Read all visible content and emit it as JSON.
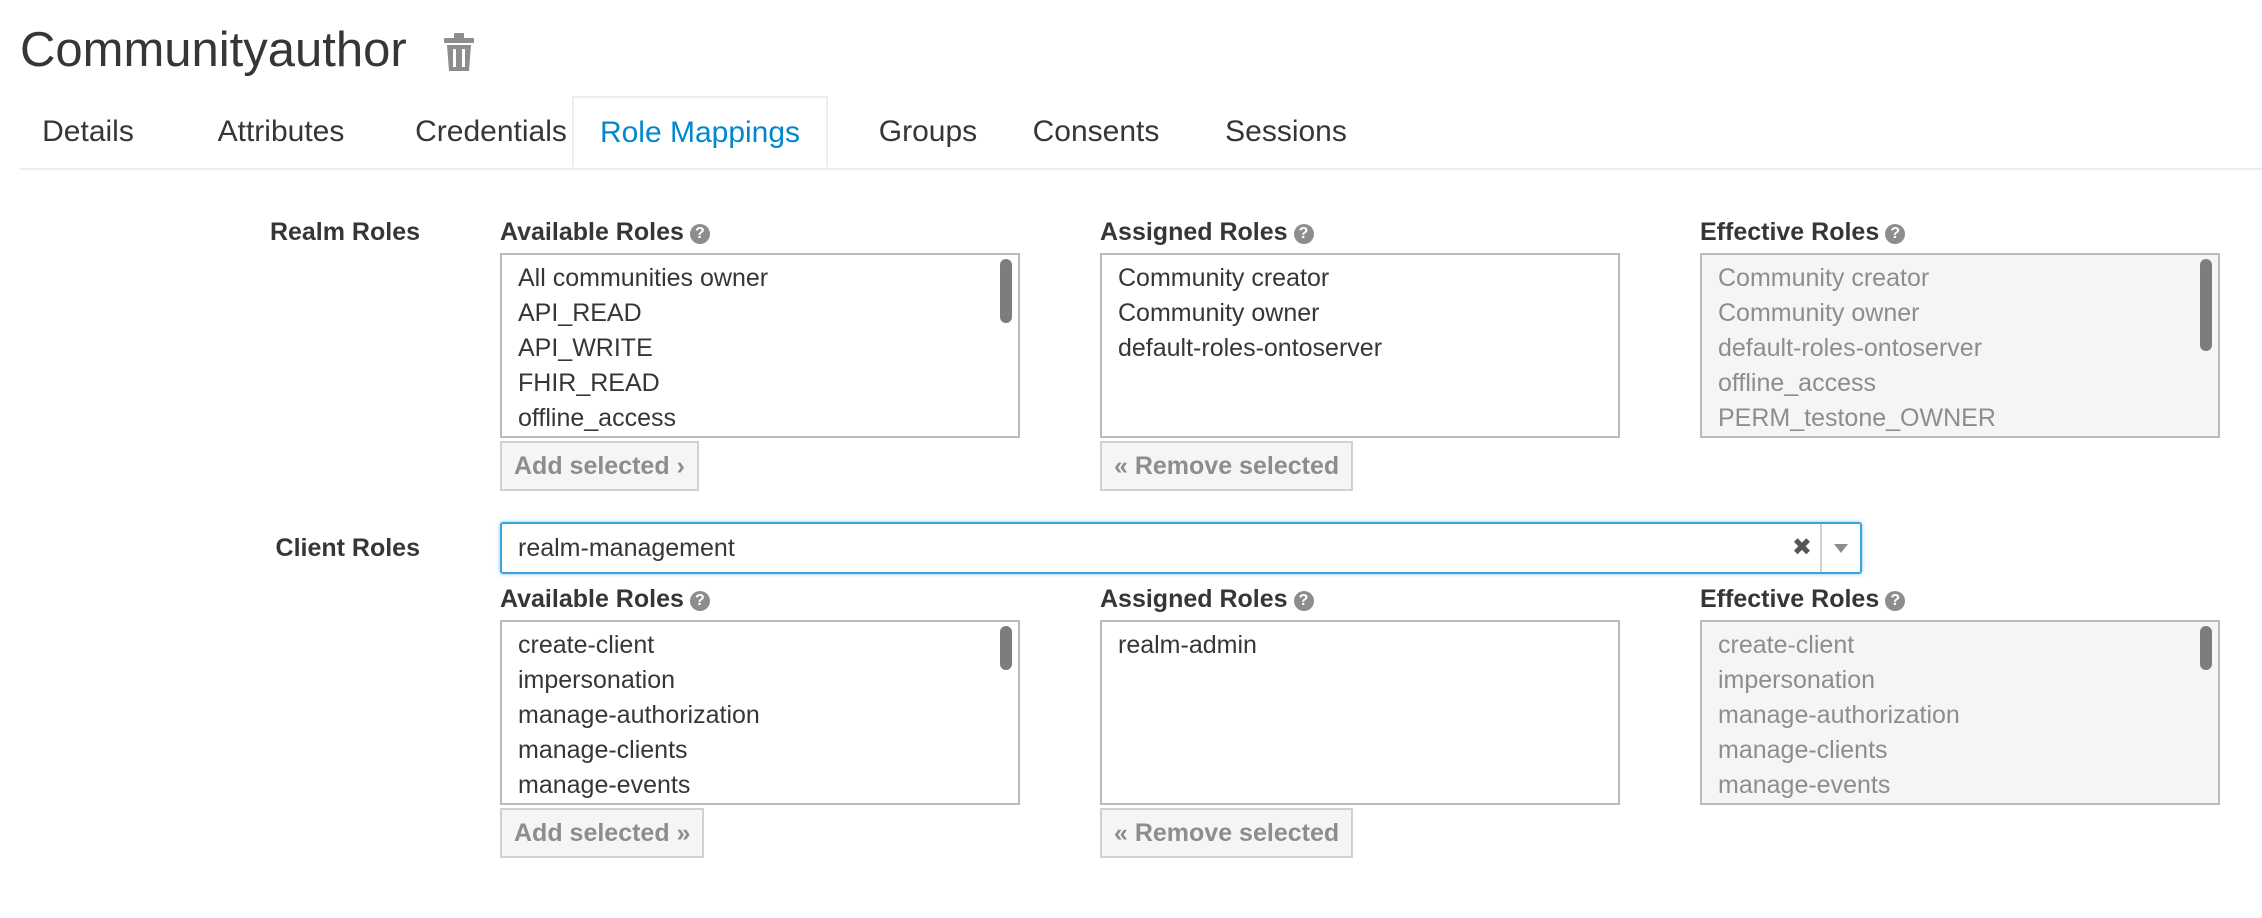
{
  "header": {
    "title": "Communityauthor",
    "delete_icon": "trash-icon"
  },
  "tabs": [
    {
      "label": "Details"
    },
    {
      "label": "Attributes"
    },
    {
      "label": "Credentials"
    },
    {
      "label": "Role Mappings",
      "active": true
    },
    {
      "label": "Groups"
    },
    {
      "label": "Consents"
    },
    {
      "label": "Sessions"
    }
  ],
  "realm": {
    "label": "Realm Roles",
    "available": {
      "heading": "Available Roles",
      "items": [
        "All communities owner",
        "API_READ",
        "API_WRITE",
        "FHIR_READ",
        "offline_access"
      ],
      "button": "Add selected ›"
    },
    "assigned": {
      "heading": "Assigned Roles",
      "items": [
        "Community creator",
        "Community owner",
        "default-roles-ontoserver"
      ],
      "button": "« Remove selected"
    },
    "effective": {
      "heading": "Effective Roles",
      "items": [
        "Community creator",
        "Community owner",
        "default-roles-ontoserver",
        "offline_access",
        "PERM_testone_OWNER"
      ]
    }
  },
  "client": {
    "label": "Client Roles",
    "select_value": "realm-management",
    "clear_symbol": "✖",
    "available": {
      "heading": "Available Roles",
      "items": [
        "create-client",
        "impersonation",
        "manage-authorization",
        "manage-clients",
        "manage-events"
      ],
      "button": "Add selected »"
    },
    "assigned": {
      "heading": "Assigned Roles",
      "items": [
        "realm-admin"
      ],
      "button": "« Remove selected"
    },
    "effective": {
      "heading": "Effective Roles",
      "items": [
        "create-client",
        "impersonation",
        "manage-authorization",
        "manage-clients",
        "manage-events"
      ]
    }
  },
  "colors": {
    "accent": "#0088ce",
    "focus_border": "#39a5dc",
    "muted_text": "#8b8d8f"
  }
}
